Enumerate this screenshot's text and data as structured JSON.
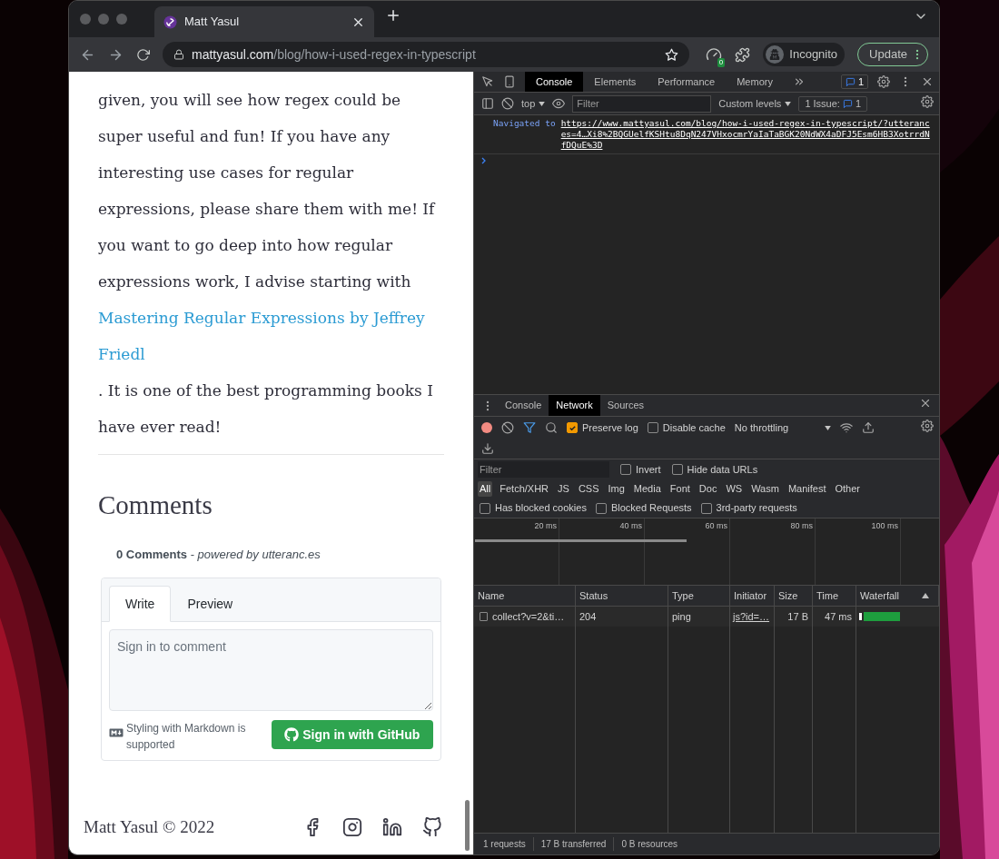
{
  "browser": {
    "tab_title": "Matt Yasul",
    "address_domain": "mattyasul.com",
    "address_path": "/blog/how-i-used-regex-in-typescript",
    "extension_badge": "0",
    "profile": "Incognito",
    "update_button": "Update"
  },
  "article": {
    "text_before": "given, you will see how regex could be super useful and fun! If you have any interesting use cases for regular expressions, please share them with me! If you want to go deep into how regular expressions work, I advise starting with",
    "link": "Mastering Regular Expressions by Jeffrey Friedl",
    "text_after": ". It is one of the best programming books I have ever read!"
  },
  "comments": {
    "heading": "Comments",
    "count_line": "**0 Comments** - *powered by utteranc.es*",
    "tabs": [
      {
        "label": "Write",
        "selected": true
      },
      {
        "label": "Preview",
        "selected": false
      }
    ],
    "placeholder": "Sign in to comment",
    "markdown_note": "Styling with Markdown is supported",
    "sign_in_button": "Sign in with GitHub"
  },
  "footer": {
    "copyright": "Matt Yasul © 2022"
  },
  "devtools": {
    "tabs": [
      {
        "label": "Console",
        "selected": true
      },
      {
        "label": "Elements",
        "selected": false
      },
      {
        "label": "Performance",
        "selected": false
      },
      {
        "label": "Memory",
        "selected": false
      }
    ],
    "messages_badge": "1",
    "console_toolbar": {
      "context": "top",
      "filter_placeholder": "Filter",
      "levels": "Custom levels",
      "issues_label": "1 Issue:",
      "issues_count": "1"
    },
    "log": {
      "prefix": "Navigated to",
      "url": "https://www.mattyasul.com/blog/how-i-used-regex-in-typescript/?utterances=4…Xi8%2BQGUelfKSHtu8DqN247VHxocmrYaIaTaBGK20NdWX4aDFJ5Esm6HB3XotrrdNfDQuE%3D"
    },
    "drawer_tabs": [
      {
        "label": "Console",
        "selected": false
      },
      {
        "label": "Network",
        "selected": true
      },
      {
        "label": "Sources",
        "selected": false
      }
    ],
    "network_toolbar": {
      "preserve_log": {
        "label": "Preserve log",
        "checked": true
      },
      "disable_cache": {
        "label": "Disable cache",
        "checked": false
      },
      "throttling": "No throttling"
    },
    "filter": {
      "placeholder": "Filter",
      "invert": {
        "label": "Invert",
        "checked": false
      },
      "hide_data_urls": {
        "label": "Hide data URLs",
        "checked": false
      }
    },
    "types": [
      {
        "label": "All",
        "selected": true
      },
      {
        "label": "Fetch/XHR",
        "selected": false
      },
      {
        "label": "JS",
        "selected": false
      },
      {
        "label": "CSS",
        "selected": false
      },
      {
        "label": "Img",
        "selected": false
      },
      {
        "label": "Media",
        "selected": false
      },
      {
        "label": "Font",
        "selected": false
      },
      {
        "label": "Doc",
        "selected": false
      },
      {
        "label": "WS",
        "selected": false
      },
      {
        "label": "Wasm",
        "selected": false
      },
      {
        "label": "Manifest",
        "selected": false
      },
      {
        "label": "Other",
        "selected": false
      }
    ],
    "blocked_filters": [
      {
        "label": "Has blocked cookies",
        "checked": false
      },
      {
        "label": "Blocked Requests",
        "checked": false
      },
      {
        "label": "3rd-party requests",
        "checked": false
      }
    ],
    "overview_ticks": [
      "20 ms",
      "40 ms",
      "60 ms",
      "80 ms",
      "100 ms"
    ],
    "columns": [
      "Name",
      "Status",
      "Type",
      "Initiator",
      "Size",
      "Time",
      "Waterfall"
    ],
    "rows": [
      {
        "name": "collect?v=2&ti…",
        "status": "204",
        "type": "ping",
        "initiator": "js?id=…",
        "size": "17 B",
        "time": "47 ms"
      }
    ],
    "status_bar": [
      "1 requests",
      "17 B transferred",
      "0 B resources"
    ]
  }
}
